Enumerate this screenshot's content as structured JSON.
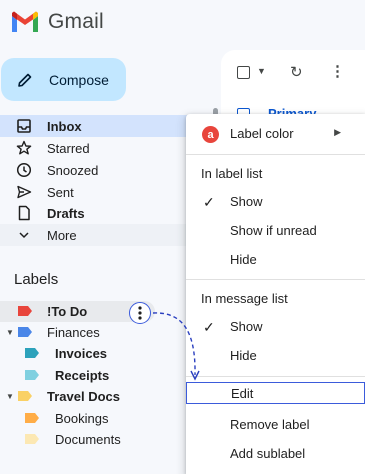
{
  "app": {
    "name": "Gmail"
  },
  "compose": {
    "label": "Compose"
  },
  "nav": {
    "items": [
      {
        "label": "Inbox",
        "icon": "inbox-icon"
      },
      {
        "label": "Starred",
        "icon": "star-icon"
      },
      {
        "label": "Snoozed",
        "icon": "clock-icon"
      },
      {
        "label": "Sent",
        "icon": "send-icon"
      },
      {
        "label": "Drafts",
        "icon": "draft-icon"
      },
      {
        "label": "More",
        "icon": "chevron-down-icon"
      }
    ]
  },
  "labels": {
    "heading": "Labels",
    "items": [
      {
        "label": "!To Do",
        "color": "#e8453c"
      },
      {
        "label": "Finances",
        "color": "#4a86e8"
      },
      {
        "label": "Invoices",
        "color": "#2da2bb"
      },
      {
        "label": "Receipts",
        "color": "#80d0e0"
      },
      {
        "label": "Travel Docs",
        "color": "#fad165"
      },
      {
        "label": "Bookings",
        "color": "#ffad47"
      },
      {
        "label": "Documents",
        "color": "#fce8b3"
      }
    ]
  },
  "mail": {
    "primary_tab": "Primary"
  },
  "menu": {
    "label_color": "Label color",
    "label_color_letter": "a",
    "label_list_heading": "In label list",
    "label_list_options": [
      "Show",
      "Show if unread",
      "Hide"
    ],
    "message_list_heading": "In message list",
    "message_list_options": [
      "Show",
      "Hide"
    ],
    "actions": [
      "Edit",
      "Remove label",
      "Add sublabel"
    ]
  },
  "colors": {
    "accent": "#0b57d0",
    "compose_bg": "#c2e7ff",
    "active_nav": "#d3e3fd",
    "highlight": "#3b5bdb"
  }
}
